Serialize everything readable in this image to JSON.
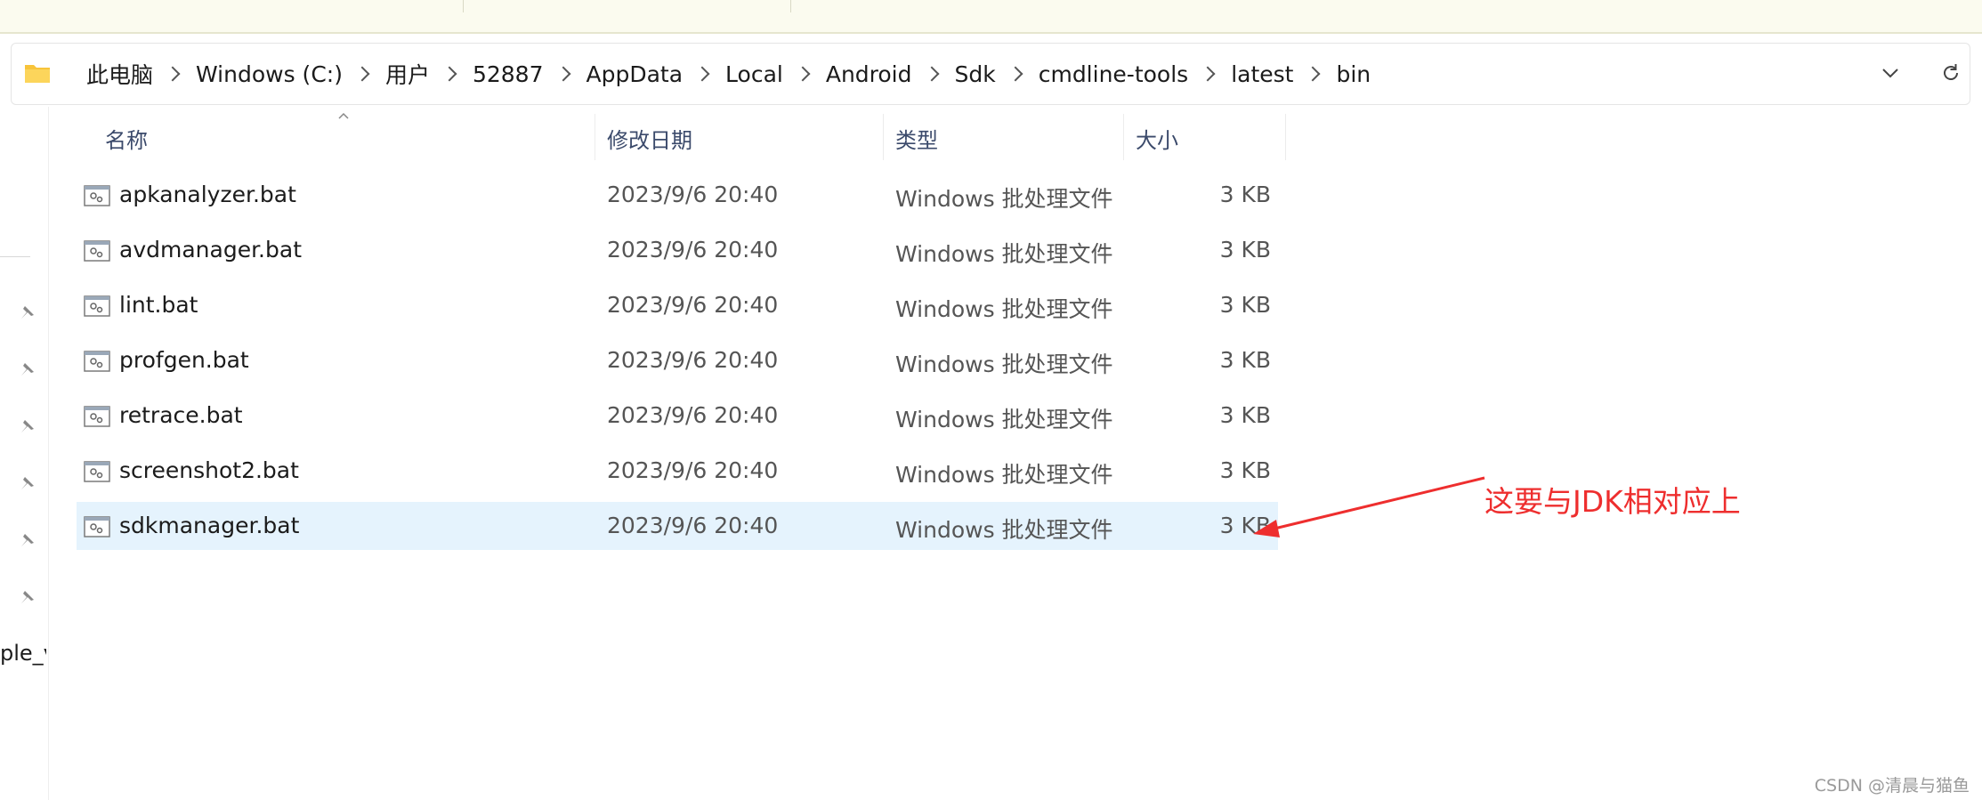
{
  "breadcrumb": [
    "此电脑",
    "Windows (C:)",
    "用户",
    "52887",
    "AppData",
    "Local",
    "Android",
    "Sdk",
    "cmdline-tools",
    "latest",
    "bin"
  ],
  "icons": {
    "folder": "folder-icon",
    "dropdown": "chevron-down-icon",
    "refresh": "refresh-icon",
    "pin": "pin-icon",
    "file": "batch-file-icon"
  },
  "nav": {
    "clipped_label": "ple_v"
  },
  "columns": {
    "name": "名称",
    "date": "修改日期",
    "type": "类型",
    "size": "大小"
  },
  "files": [
    {
      "name": "apkanalyzer.bat",
      "date": "2023/9/6 20:40",
      "type": "Windows 批处理文件",
      "size": "3 KB",
      "selected": false
    },
    {
      "name": "avdmanager.bat",
      "date": "2023/9/6 20:40",
      "type": "Windows 批处理文件",
      "size": "3 KB",
      "selected": false
    },
    {
      "name": "lint.bat",
      "date": "2023/9/6 20:40",
      "type": "Windows 批处理文件",
      "size": "3 KB",
      "selected": false
    },
    {
      "name": "profgen.bat",
      "date": "2023/9/6 20:40",
      "type": "Windows 批处理文件",
      "size": "3 KB",
      "selected": false
    },
    {
      "name": "retrace.bat",
      "date": "2023/9/6 20:40",
      "type": "Windows 批处理文件",
      "size": "3 KB",
      "selected": false
    },
    {
      "name": "screenshot2.bat",
      "date": "2023/9/6 20:40",
      "type": "Windows 批处理文件",
      "size": "3 KB",
      "selected": false
    },
    {
      "name": "sdkmanager.bat",
      "date": "2023/9/6 20:40",
      "type": "Windows 批处理文件",
      "size": "3 KB",
      "selected": true
    }
  ],
  "annotation": {
    "text": "这要与JDK相对应上",
    "color": "#ee2e2e"
  },
  "watermark": "CSDN @清晨与猫鱼",
  "colors": {
    "selection": "#e5f3fd",
    "header_text": "#3b4a6b",
    "folder": "#f8c43a"
  }
}
